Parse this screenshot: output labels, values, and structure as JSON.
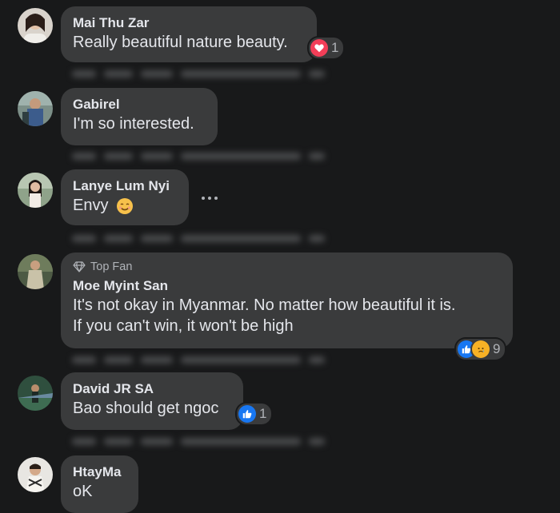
{
  "comments": [
    {
      "name": "Mai Thu Zar",
      "text": "Really beautiful nature beauty.",
      "reaction_count": "1",
      "reaction": "love"
    },
    {
      "name": "Gabirel",
      "text": "I'm so interested."
    },
    {
      "name": "Lanye Lum Nyi",
      "text": "Envy",
      "emoji": "smiling-face"
    },
    {
      "badge": "Top Fan",
      "name": "Moe Myint San",
      "text_line1": "It's not okay in Myanmar. No matter how beautiful it is.",
      "text_line2": "If you can't win, it won't be high",
      "reaction_count": "9",
      "reaction": "like+sad"
    },
    {
      "name": "David JR SA",
      "text": "Bao should get ngoc",
      "reaction_count": "1",
      "reaction": "like"
    },
    {
      "name": "HtayMa",
      "text": "oK"
    }
  ],
  "colors": {
    "background": "#18191a",
    "bubble": "#3a3b3c",
    "text": "#e4e6eb",
    "secondary": "#b0b3b8",
    "love": "#f33e58",
    "like": "#1877f2",
    "sad": "#f7b125"
  },
  "icons": [
    "love-reaction-icon",
    "like-reaction-icon",
    "sad-reaction-icon",
    "diamond-icon",
    "more-options-icon",
    "smiling-face-emoji"
  ]
}
